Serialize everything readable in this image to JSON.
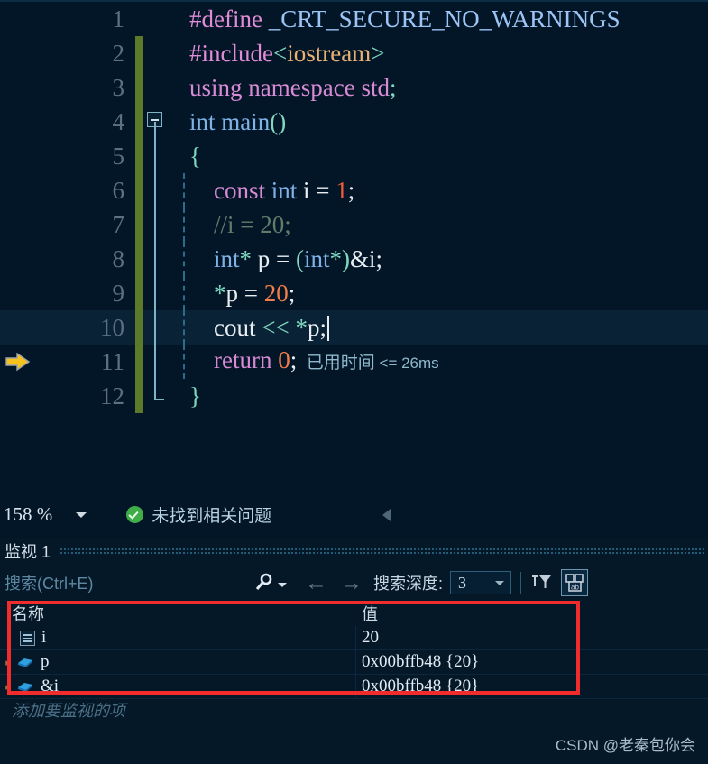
{
  "editor": {
    "lines": [
      {
        "num": "1",
        "changed": false,
        "fold": "none",
        "indent": false,
        "current": false,
        "tokens": [
          {
            "t": "#define ",
            "c": "tk-pre"
          },
          {
            "t": "_CRT_SECURE_NO_WARNINGS",
            "c": "tk-mac"
          }
        ]
      },
      {
        "num": "2",
        "changed": true,
        "fold": "none",
        "indent": false,
        "current": false,
        "tokens": [
          {
            "t": "#include",
            "c": "tk-pre"
          },
          {
            "t": "<",
            "c": "tk-punc"
          },
          {
            "t": "iostream",
            "c": "tk-inc"
          },
          {
            "t": ">",
            "c": "tk-punc"
          }
        ]
      },
      {
        "num": "3",
        "changed": true,
        "fold": "none",
        "indent": false,
        "current": false,
        "tokens": [
          {
            "t": "using namespace ",
            "c": "tk-kw"
          },
          {
            "t": "std",
            "c": "tk-kw"
          },
          {
            "t": ";",
            "c": "tk-punc"
          }
        ]
      },
      {
        "num": "4",
        "changed": true,
        "fold": "box",
        "indent": false,
        "current": false,
        "tokens": [
          {
            "t": "int ",
            "c": "tk-kw2"
          },
          {
            "t": "main",
            "c": "tk-kw2"
          },
          {
            "t": "()",
            "c": "tk-punc"
          }
        ]
      },
      {
        "num": "5",
        "changed": true,
        "fold": "line",
        "indent": false,
        "current": false,
        "tokens": [
          {
            "t": "{",
            "c": "tk-punc"
          }
        ]
      },
      {
        "num": "6",
        "changed": true,
        "fold": "line",
        "indent": true,
        "current": false,
        "tokens": [
          {
            "t": "    const ",
            "c": "tk-kw"
          },
          {
            "t": "int ",
            "c": "tk-kw2"
          },
          {
            "t": "i",
            "c": "tk-white"
          },
          {
            "t": " = ",
            "c": "tk-white"
          },
          {
            "t": "1",
            "c": "tk-num2"
          },
          {
            "t": ";",
            "c": "tk-white"
          }
        ]
      },
      {
        "num": "7",
        "changed": true,
        "fold": "line",
        "indent": true,
        "current": false,
        "tokens": [
          {
            "t": "    //i = 20;",
            "c": "tk-cmt"
          }
        ]
      },
      {
        "num": "8",
        "changed": true,
        "fold": "line",
        "indent": true,
        "current": false,
        "tokens": [
          {
            "t": "    int",
            "c": "tk-kw2"
          },
          {
            "t": "* ",
            "c": "tk-punc"
          },
          {
            "t": "p",
            "c": "tk-white"
          },
          {
            "t": " = ",
            "c": "tk-white"
          },
          {
            "t": "(",
            "c": "tk-punc"
          },
          {
            "t": "int",
            "c": "tk-kw2"
          },
          {
            "t": "*",
            "c": "tk-punc"
          },
          {
            "t": ")",
            "c": "tk-punc"
          },
          {
            "t": "&i",
            "c": "tk-white"
          },
          {
            "t": ";",
            "c": "tk-white"
          }
        ]
      },
      {
        "num": "9",
        "changed": true,
        "fold": "line",
        "indent": true,
        "current": false,
        "tokens": [
          {
            "t": "    ",
            "c": "tk-white"
          },
          {
            "t": "*",
            "c": "tk-punc"
          },
          {
            "t": "p",
            "c": "tk-white"
          },
          {
            "t": " = ",
            "c": "tk-white"
          },
          {
            "t": "20",
            "c": "tk-num"
          },
          {
            "t": ";",
            "c": "tk-white"
          }
        ]
      },
      {
        "num": "10",
        "changed": true,
        "fold": "line",
        "indent": true,
        "current": true,
        "tokens": [
          {
            "t": "    cout ",
            "c": "tk-white"
          },
          {
            "t": "<<",
            "c": "tk-punc"
          },
          {
            "t": " ",
            "c": "tk-white"
          },
          {
            "t": "*",
            "c": "tk-punc"
          },
          {
            "t": "p",
            "c": "tk-white"
          },
          {
            "t": ";",
            "c": "tk-white"
          }
        ],
        "caret": true
      },
      {
        "num": "11",
        "changed": true,
        "fold": "line",
        "indent": true,
        "current": false,
        "exec_arrow": true,
        "tokens": [
          {
            "t": "    return ",
            "c": "tk-kw"
          },
          {
            "t": "0",
            "c": "tk-num"
          },
          {
            "t": ";",
            "c": "tk-white"
          }
        ],
        "elapsed": "已用时间",
        "elapsed_ms": " <= 26ms"
      },
      {
        "num": "12",
        "changed": true,
        "fold": "end",
        "indent": false,
        "current": false,
        "tokens": [
          {
            "t": "}",
            "c": "tk-punc"
          }
        ]
      }
    ]
  },
  "statusbar": {
    "zoom": "158 %",
    "problems": "未找到相关问题"
  },
  "watch": {
    "title": "监视 1",
    "search_placeholder": "搜索(Ctrl+E)",
    "depth_label": "搜索深度:",
    "depth_value": "3",
    "columns": {
      "name": "名称",
      "value": "值"
    },
    "rows": [
      {
        "expander": "",
        "icon": "field-icon",
        "name": "i",
        "value": "20"
      },
      {
        "expander": "▸",
        "icon": "pointer-icon",
        "name": "p",
        "value": "0x00bffb48 {20}"
      },
      {
        "expander": "▸",
        "icon": "pointer-icon",
        "name": "&i",
        "value": "0x00bffb48 {20}"
      }
    ],
    "add_watch": "添加要监视的项"
  },
  "watermark": "CSDN @老秦包你会",
  "colors": {
    "editor_bg": "#031627",
    "change_bar": "#5d7a2b",
    "highlight_box": "#f12c2c",
    "exec_arrow": "#f7c21c",
    "ok_green": "#3fae49"
  }
}
